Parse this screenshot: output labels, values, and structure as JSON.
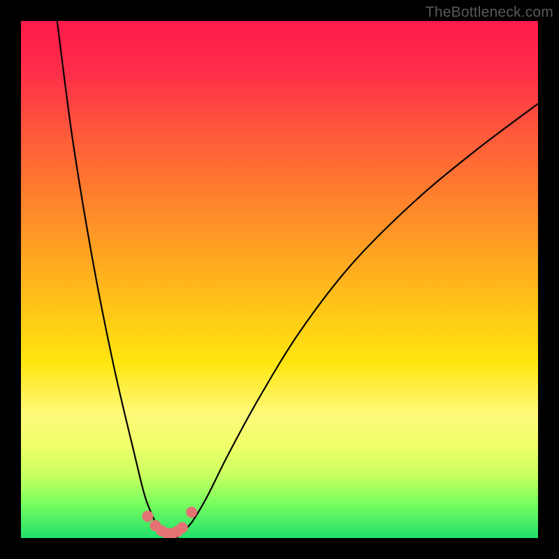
{
  "watermark": "TheBottleneck.com",
  "chart_data": {
    "type": "line",
    "title": "",
    "xlabel": "",
    "ylabel": "",
    "xlim": [
      0,
      100
    ],
    "ylim": [
      0,
      100
    ],
    "series": [
      {
        "name": "bottleneck-curve",
        "x": [
          7,
          10,
          14,
          18,
          22,
          24,
          26,
          27,
          28,
          29,
          30,
          31,
          33,
          36,
          40,
          46,
          54,
          64,
          76,
          88,
          100
        ],
        "values": [
          100,
          77,
          53,
          33,
          16,
          8,
          3,
          1,
          0,
          0,
          0,
          1,
          3,
          8,
          16,
          27,
          40,
          53,
          65,
          75,
          84
        ]
      }
    ],
    "markers": {
      "name": "valley-markers",
      "color": "#e57373",
      "x": [
        24.5,
        26.0,
        27.2,
        28.3,
        29.4,
        30.3,
        31.2,
        33.0
      ],
      "values": [
        4.2,
        2.4,
        1.4,
        0.9,
        0.9,
        1.3,
        2.0,
        5.0
      ]
    }
  }
}
